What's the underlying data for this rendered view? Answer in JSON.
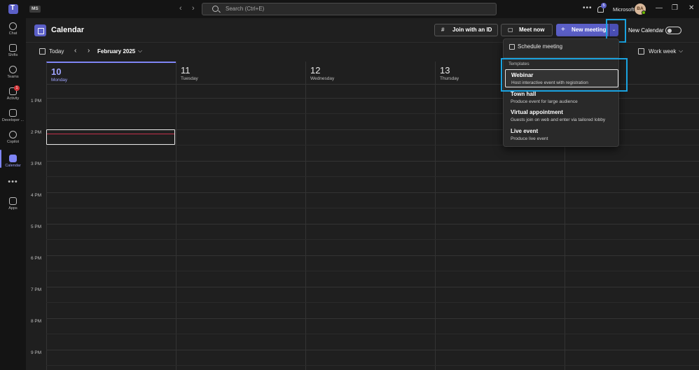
{
  "titlebar": {
    "org_badge": "MS",
    "search_placeholder": "Search (Ctrl+E)",
    "notification_count": "5",
    "org_name": "Microsoft",
    "avatar_initials": "BA"
  },
  "rail": {
    "items": [
      {
        "label": "Chat"
      },
      {
        "label": "Shifts"
      },
      {
        "label": "Teams"
      },
      {
        "label": "Activity",
        "badge": "1"
      },
      {
        "label": "Developer ..."
      },
      {
        "label": "Copilot"
      },
      {
        "label": "Calendar"
      },
      {
        "label": "Apps"
      }
    ]
  },
  "header": {
    "title": "Calendar",
    "join_label": "Join with an ID",
    "meet_now_label": "Meet now",
    "new_meeting_label": "New meeting",
    "new_calendar_label": "New Calendar"
  },
  "subbar": {
    "today_label": "Today",
    "month_label": "February 2025",
    "view_label": "Work week"
  },
  "days": [
    {
      "num": "10",
      "name": "Monday"
    },
    {
      "num": "11",
      "name": "Tuesday"
    },
    {
      "num": "12",
      "name": "Wednesday"
    },
    {
      "num": "13",
      "name": "Thursday"
    }
  ],
  "times": [
    "1 PM",
    "2 PM",
    "3 PM",
    "4 PM",
    "5 PM",
    "6 PM",
    "7 PM",
    "8 PM",
    "9 PM"
  ],
  "menu": {
    "schedule_label": "Schedule meeting",
    "section_label": "Templates",
    "items": [
      {
        "title": "Webinar",
        "desc": "Host interactive event with registration"
      },
      {
        "title": "Town hall",
        "desc": "Produce event for large audience"
      },
      {
        "title": "Virtual appointment",
        "desc": "Guests join on web and enter via tailored lobby"
      },
      {
        "title": "Live event",
        "desc": "Produce live event"
      }
    ]
  },
  "colors": {
    "accent": "#5b5fc7",
    "highlight": "#1aa3e0",
    "current_time": "#c4314b"
  }
}
